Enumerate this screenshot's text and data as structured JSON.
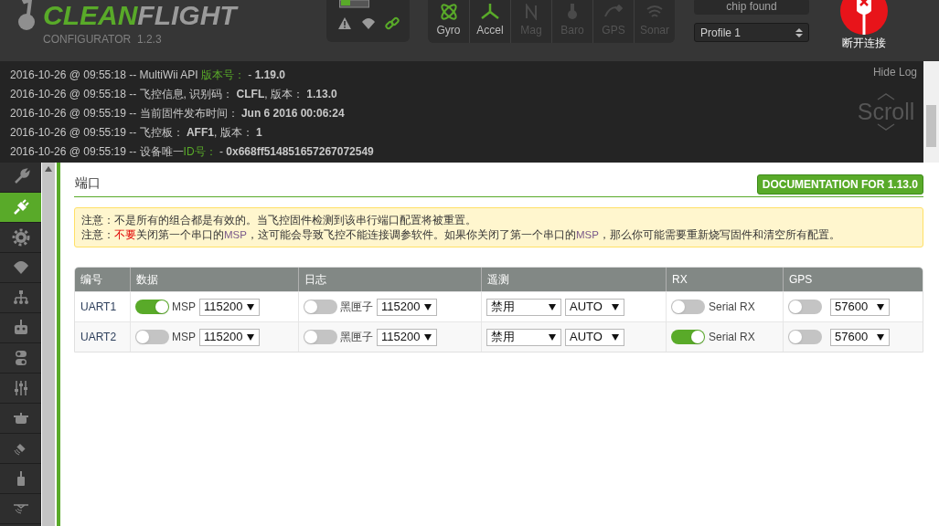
{
  "header": {
    "logo": {
      "word_green": "CLEAN",
      "word_grey": "FLIGHT",
      "subtitle": "CONFIGURATOR  1.2.3"
    },
    "status_icons": [
      {
        "kind": "warning",
        "on": false
      },
      {
        "kind": "failsafe",
        "on": false
      },
      {
        "kind": "link",
        "on": true
      }
    ],
    "sensors": [
      {
        "label": "Gyro",
        "kind": "gyro",
        "active": true
      },
      {
        "label": "Accel",
        "kind": "accel",
        "active": true
      },
      {
        "label": "Mag",
        "kind": "mag",
        "active": false
      },
      {
        "label": "Baro",
        "kind": "baro",
        "active": false
      },
      {
        "label": "GPS",
        "kind": "gps",
        "active": false
      },
      {
        "label": "Sonar",
        "kind": "sonar",
        "active": false
      }
    ],
    "chip_status": "chip found",
    "profile": "Profile 1",
    "disconnect_label": "断开连接"
  },
  "log": {
    "hide_label": "Hide Log",
    "scroll_label": "Scroll",
    "lines": [
      [
        {
          "kind": "plain",
          "text": "2016-10-26 @ 09:55:18 -- MultiWii API "
        },
        {
          "kind": "green",
          "text": "版本号："
        },
        {
          "kind": "plain",
          "text": " - "
        },
        {
          "kind": "bold",
          "text": "1.19.0"
        }
      ],
      [
        {
          "kind": "plain",
          "text": "2016-10-26 @ 09:55:18 -- 飞控信息, 识别码： "
        },
        {
          "kind": "bold",
          "text": "CLFL"
        },
        {
          "kind": "plain",
          "text": ", 版本： "
        },
        {
          "kind": "bold",
          "text": "1.13.0"
        }
      ],
      [
        {
          "kind": "plain",
          "text": "2016-10-26 @ 09:55:19 -- 当前固件发布时间： "
        },
        {
          "kind": "bold",
          "text": "Jun 6 2016 00:06:24"
        }
      ],
      [
        {
          "kind": "plain",
          "text": "2016-10-26 @ 09:55:19 -- 飞控板： "
        },
        {
          "kind": "bold",
          "text": "AFF1"
        },
        {
          "kind": "plain",
          "text": ", 版本： "
        },
        {
          "kind": "bold",
          "text": "1"
        }
      ],
      [
        {
          "kind": "plain",
          "text": "2016-10-26 @ 09:55:19 -- 设备唯一"
        },
        {
          "kind": "green",
          "text": "ID号："
        },
        {
          "kind": "plain",
          "text": " - "
        },
        {
          "kind": "bold",
          "text": "0x668ff514851657267072549"
        }
      ]
    ]
  },
  "sidebar": {
    "items": [
      {
        "kind": "wrench",
        "selected": false
      },
      {
        "kind": "plug",
        "selected": true
      },
      {
        "kind": "gear",
        "selected": false
      },
      {
        "kind": "parachute",
        "selected": false
      },
      {
        "kind": "tree",
        "selected": false
      },
      {
        "kind": "receiver",
        "selected": false
      },
      {
        "kind": "switches",
        "selected": false
      },
      {
        "kind": "sliders",
        "selected": false
      },
      {
        "kind": "pot",
        "selected": false
      },
      {
        "kind": "satellite",
        "selected": false
      },
      {
        "kind": "bottle",
        "selected": false
      },
      {
        "kind": "drone",
        "selected": false
      }
    ]
  },
  "page": {
    "title": "端口",
    "doc_button": "DOCUMENTATION FOR 1.13.0",
    "notes": [
      [
        {
          "kind": "plain",
          "text": "注意：不是所有的组合都是有效的。当飞控固件检测到该串行端口配置将被重置。"
        }
      ],
      [
        {
          "kind": "plain",
          "text": "注意："
        },
        {
          "kind": "red",
          "text": "不要"
        },
        {
          "kind": "plain",
          "text": "关闭第一个串口的"
        },
        {
          "kind": "code",
          "text": "MSP"
        },
        {
          "kind": "plain",
          "text": "，这可能会导致飞控不能连接调参软件。如果你关闭了第一个串口的"
        },
        {
          "kind": "code",
          "text": "MSP"
        },
        {
          "kind": "plain",
          "text": "，那么你可能需要重新烧写固件和清空所有配置。"
        }
      ]
    ],
    "table": {
      "columns": [
        "编号",
        "数据",
        "日志",
        "遥测",
        "RX",
        "GPS"
      ],
      "rows": [
        {
          "id": "UART1",
          "msp": {
            "on": true,
            "label": "MSP",
            "baud": "115200"
          },
          "blackbox": {
            "on": false,
            "label": "黑匣子",
            "baud": "115200"
          },
          "telemetry": {
            "mode": "禁用",
            "baud": "AUTO"
          },
          "rx": {
            "on": false,
            "label": "Serial RX"
          },
          "gps": {
            "on": false,
            "baud": "57600"
          }
        },
        {
          "id": "UART2",
          "msp": {
            "on": false,
            "label": "MSP",
            "baud": "115200"
          },
          "blackbox": {
            "on": false,
            "label": "黑匣子",
            "baud": "115200"
          },
          "telemetry": {
            "mode": "禁用",
            "baud": "AUTO"
          },
          "rx": {
            "on": true,
            "label": "Serial RX"
          },
          "gps": {
            "on": false,
            "baud": "57600"
          }
        }
      ]
    }
  }
}
